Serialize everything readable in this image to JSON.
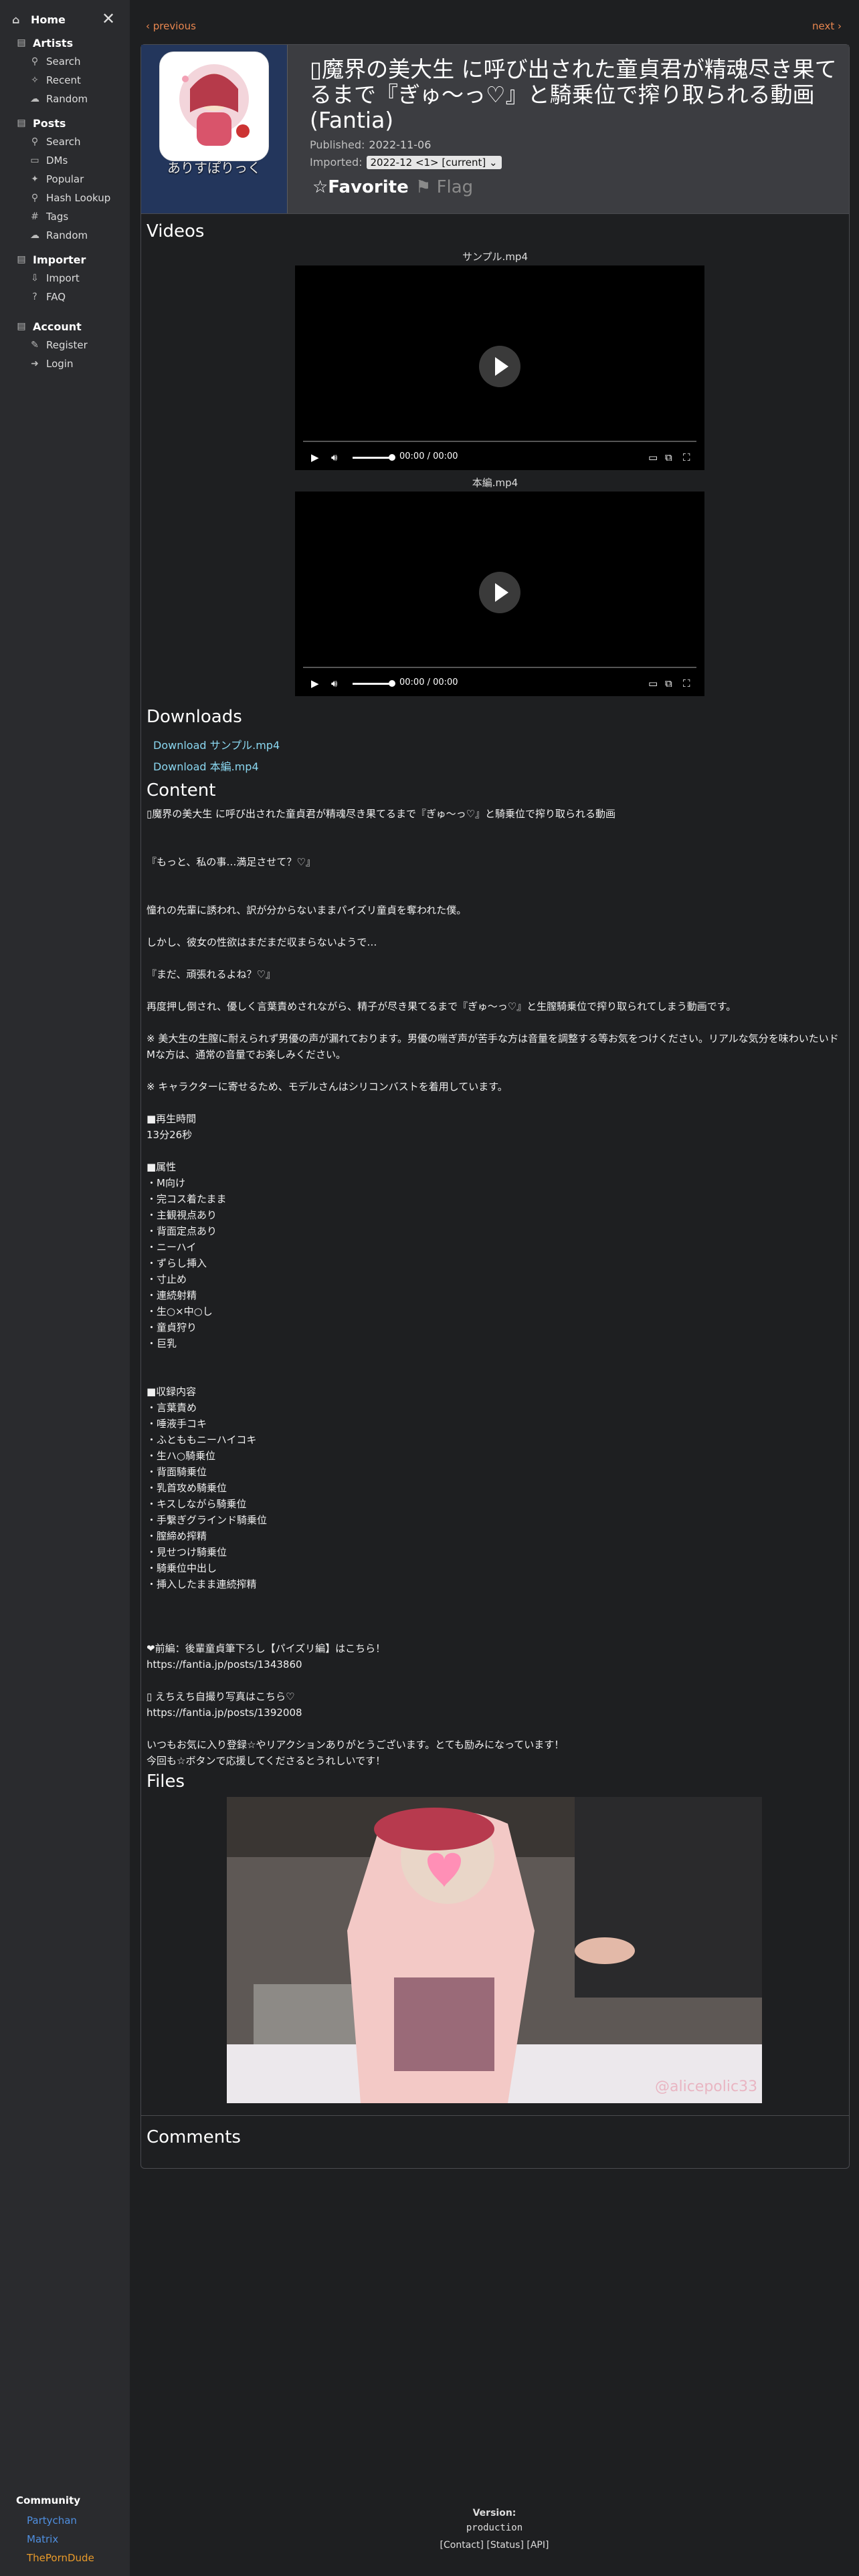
{
  "sidebar": {
    "home": "Home",
    "sections": [
      {
        "label": "Artists",
        "items": [
          "Search",
          "Recent",
          "Random"
        ]
      },
      {
        "label": "Posts",
        "items": [
          "Search",
          "DMs",
          "Popular",
          "Hash Lookup",
          "Tags",
          "Random"
        ]
      },
      {
        "label": "Importer",
        "items": [
          "Import",
          "FAQ"
        ]
      },
      {
        "label": "Account",
        "items": [
          "Register",
          "Login"
        ]
      }
    ],
    "community": {
      "label": "Community",
      "links": [
        "Partychan",
        "Matrix",
        "ThePornDude"
      ]
    }
  },
  "nav": {
    "previous": "‹ previous",
    "next": "next ›"
  },
  "post": {
    "artist": "ありすぽりっく",
    "title": "▯魔界の美大生 に呼び出された童貞君が精魂尽き果てるまで『ぎゅ～っ♡』と騎乗位で搾り取られる動画 (Fantia)",
    "published_label": "Published:",
    "published": "2022-11-06",
    "imported_label": "Imported:",
    "imported": "2022-12 <1> [current]",
    "favorite": "☆Favorite",
    "flag": "⚑ Flag"
  },
  "videos": {
    "heading": "Videos",
    "items": [
      {
        "name": "サンプル.mp4",
        "time": "00:00 / 00:00"
      },
      {
        "name": "本編.mp4",
        "time": "00:00 / 00:00"
      }
    ]
  },
  "downloads": {
    "heading": "Downloads",
    "items": [
      "Download サンプル.mp4",
      "Download 本編.mp4"
    ]
  },
  "content": {
    "heading": "Content",
    "text": "▯魔界の美大生 に呼び出された童貞君が精魂尽き果てるまで『ぎゅ～っ♡』と騎乗位で搾り取られる動画\n\n\n『もっと、私の事…満足させて？♡』\n\n\n憧れの先輩に誘われ、訳が分からないままパイズリ童貞を奪われた僕。\n\nしかし、彼女の性欲はまだまだ収まらないようで…\n\n『まだ、頑張れるよね？♡』\n\n再度押し倒され、優しく言葉責めされながら、精子が尽き果てるまで『ぎゅ～っ♡』と生膣騎乗位で搾り取られてしまう動画です。\n\n※ 美大生の生膣に耐えられず男優の声が漏れております。男優の喘ぎ声が苦手な方は音量を調整する等お気をつけください。リアルな気分を味わいたいドMな方は、通常の音量でお楽しみください。\n\n※ キャラクターに寄せるため、モデルさんはシリコンバストを着用しています。\n\n■再生時間\n13分26秒\n\n■属性\n・M向け\n・完コス着たまま\n・主観視点あり\n・背面定点あり\n・ニーハイ\n・ずらし挿入\n・寸止め\n・連続射精\n・生○×中○し\n・童貞狩り\n・巨乳\n\n\n■収録内容\n・言葉責め\n・唾液手コキ\n・ふとももニーハイコキ\n・生ハ○騎乗位\n・背面騎乗位\n・乳首攻め騎乗位\n・キスしながら騎乗位\n・手繋ぎグラインド騎乗位\n・膣締め搾精\n・見せつけ騎乗位\n・騎乗位中出し\n・挿入したまま連続搾精\n\n\n\n❤前編：後輩童貞筆下ろし【パイズリ編】はこちら！\nhttps://fantia.jp/posts/1343860\n\n▯ えちえち自撮り写真はこちら♡\nhttps://fantia.jp/posts/1392008\n\nいつもお気に入り登録☆やリアクションありがとうございます。とても励みになっています！\n今回も☆ボタンで応援してくださるとうれしいです！"
  },
  "files": {
    "heading": "Files",
    "watermark": "@alicepolic33"
  },
  "comments": {
    "heading": "Comments"
  },
  "footer": {
    "version_label": "Version:",
    "version": "production",
    "links": "[Contact]  [Status]  [API]"
  },
  "colors": {
    "accent": "#e8864f",
    "link": "#8ad7f0",
    "sidebar": "#2a2b2e",
    "artist_panel": "#23365c"
  }
}
